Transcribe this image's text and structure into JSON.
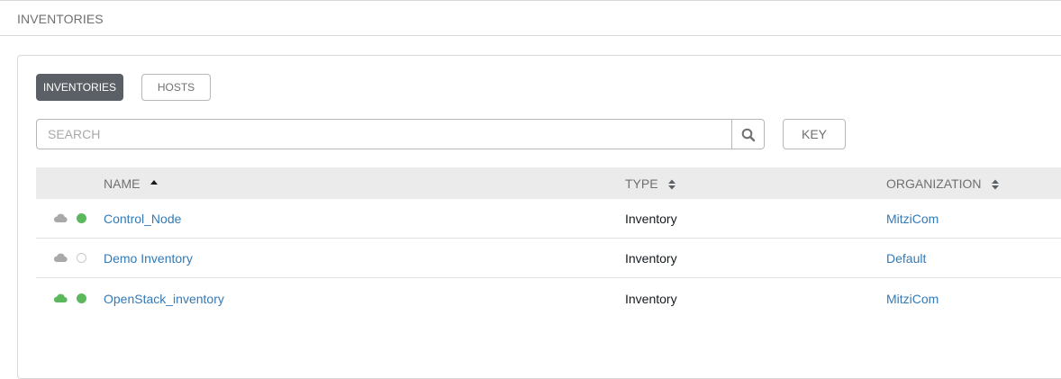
{
  "header": {
    "title": "INVENTORIES"
  },
  "tabs": [
    {
      "label": "INVENTORIES",
      "active": true
    },
    {
      "label": "HOSTS",
      "active": false
    }
  ],
  "search": {
    "placeholder": "SEARCH",
    "value": "",
    "icon": "search-icon"
  },
  "key_button": {
    "label": "KEY"
  },
  "table": {
    "columns": [
      {
        "label": "NAME",
        "sort": "ascending"
      },
      {
        "label": "TYPE",
        "sort": "unsorted"
      },
      {
        "label": "ORGANIZATION",
        "sort": "unsorted"
      }
    ],
    "rows": [
      {
        "name": "Control_Node",
        "type": "Inventory",
        "organization": "MitziCom",
        "cloud_status": "inactive",
        "status": "ok"
      },
      {
        "name": "Demo Inventory",
        "type": "Inventory",
        "organization": "Default",
        "cloud_status": "inactive",
        "status": "none"
      },
      {
        "name": "OpenStack_inventory",
        "type": "Inventory",
        "organization": "MitziCom",
        "cloud_status": "active",
        "status": "ok"
      }
    ]
  },
  "colors": {
    "accent_active_tab": "#5b5f66",
    "link": "#337ab7",
    "status_ok": "#5cb85c",
    "cloud_inactive": "#a9a9a9",
    "header_bg": "#ebebeb"
  }
}
